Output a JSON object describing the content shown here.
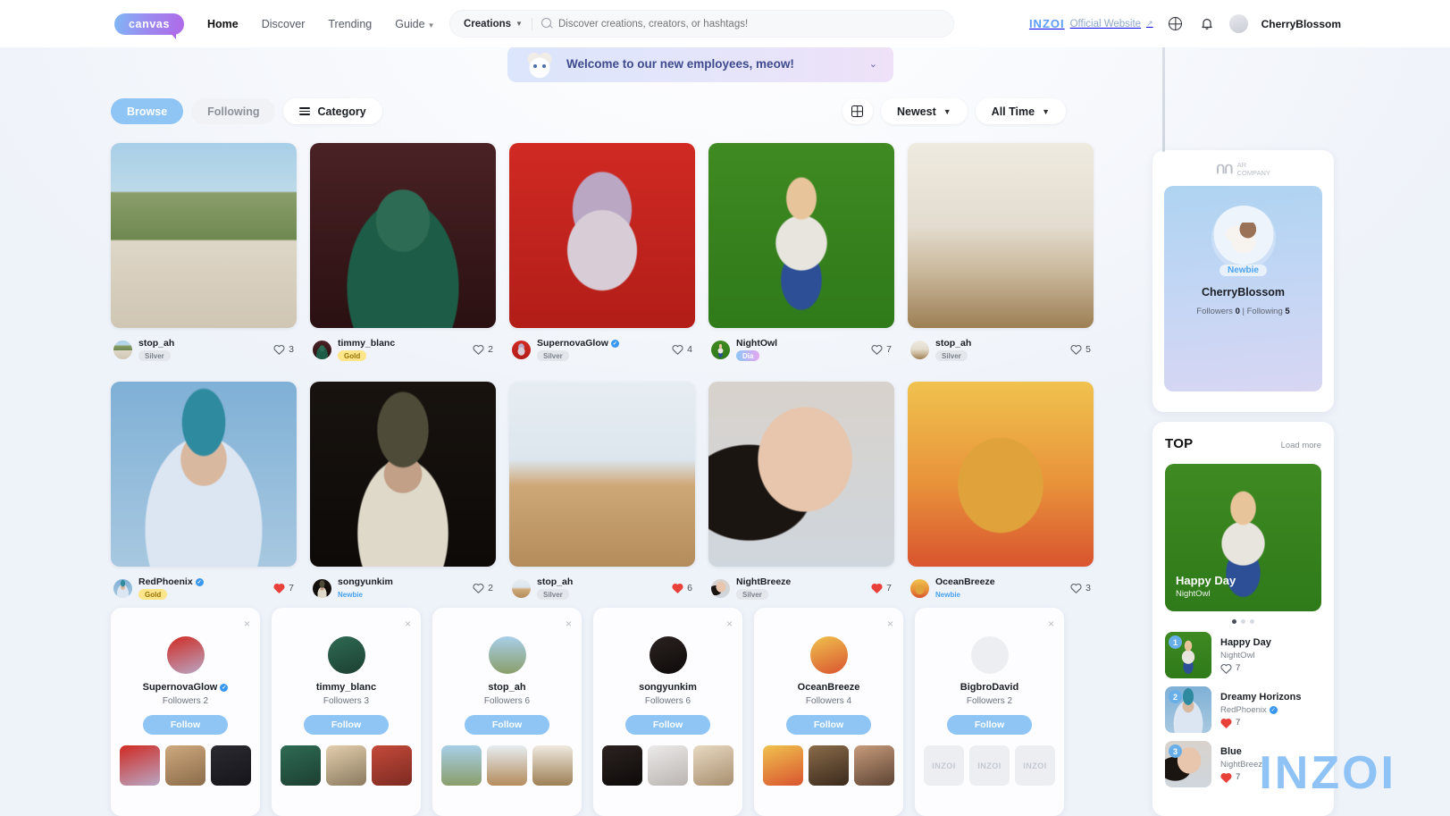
{
  "header": {
    "logo_text": "canvas",
    "nav": [
      {
        "label": "Home",
        "active": true
      },
      {
        "label": "Discover",
        "active": false
      },
      {
        "label": "Trending",
        "active": false
      },
      {
        "label": "Guide",
        "active": false,
        "caret": true
      }
    ],
    "search": {
      "scope_label": "Creations",
      "placeholder": "Discover creations, creators, or hashtags!",
      "value": ""
    },
    "inzoi_mark": "INZOI",
    "inzoi_link_label": "Official Website",
    "icons": {
      "globe": "globe-icon",
      "bell": "bell-icon"
    },
    "user_name": "CherryBlossom"
  },
  "banner": {
    "text": "Welcome to our new employees, meow!",
    "chevron": "⌄"
  },
  "filters": {
    "tabs": [
      {
        "label": "Browse",
        "active": true
      },
      {
        "label": "Following",
        "active": false
      }
    ],
    "category_label": "Category",
    "sort_label": "Newest",
    "time_label": "All Time"
  },
  "gallery": {
    "rows": [
      [
        {
          "user": "stop_ah",
          "badge": "Silver",
          "badge_type": "silver",
          "verified": false,
          "likes": "3",
          "liked": false,
          "thumb": "house-exterior"
        },
        {
          "user": "timmy_blanc",
          "badge": "Gold",
          "badge_type": "gold",
          "verified": false,
          "likes": "2",
          "liked": false,
          "thumb": "green-dress-portrait"
        },
        {
          "user": "SupernovaGlow",
          "badge": "Silver",
          "badge_type": "silver",
          "verified": true,
          "likes": "4",
          "liked": false,
          "thumb": "pigtails-red-bg"
        },
        {
          "user": "NightOwl",
          "badge": "Dia",
          "badge_type": "dia",
          "verified": false,
          "likes": "7",
          "liked": false,
          "thumb": "baseball-boy-green"
        },
        {
          "user": "stop_ah",
          "badge": "Silver",
          "badge_type": "silver",
          "verified": false,
          "likes": "5",
          "liked": false,
          "thumb": "living-room-interior"
        }
      ],
      [
        {
          "user": "RedPhoenix",
          "badge": "Gold",
          "badge_type": "gold",
          "verified": true,
          "likes": "7",
          "liked": true,
          "thumb": "beanie-girl-sky"
        },
        {
          "user": "songyunkim",
          "badge": "Newbie",
          "badge_type": "newbie",
          "verified": false,
          "likes": "2",
          "liked": false,
          "thumb": "bucket-hat-dark"
        },
        {
          "user": "stop_ah",
          "badge": "Silver",
          "badge_type": "silver",
          "verified": false,
          "likes": "6",
          "liked": true,
          "thumb": "home-gym-interior"
        },
        {
          "user": "NightBreeze",
          "badge": "Silver",
          "badge_type": "silver",
          "verified": false,
          "likes": "7",
          "liked": true,
          "thumb": "closeup-face-portrait"
        },
        {
          "user": "OceanBreeze",
          "badge": "Newbie",
          "badge_type": "newbie",
          "verified": false,
          "likes": "3",
          "liked": false,
          "thumb": "muscular-sunset"
        }
      ]
    ]
  },
  "suggestions": {
    "follow_label": "Follow",
    "close_label": "×",
    "cards": [
      {
        "name": "SupernovaGlow",
        "verified": true,
        "followers": "Followers 2",
        "minis": [
          "pigtails",
          "blond-man",
          "dark-suit"
        ]
      },
      {
        "name": "timmy_blanc",
        "verified": false,
        "followers": "Followers 3",
        "minis": [
          "green-dress",
          "blond-portrait",
          "red-hair"
        ]
      },
      {
        "name": "stop_ah",
        "verified": false,
        "followers": "Followers 6",
        "minis": [
          "house",
          "gym",
          "bedroom"
        ]
      },
      {
        "name": "songyunkim",
        "verified": false,
        "followers": "Followers 6",
        "minis": [
          "dark-portrait",
          "white-hair",
          "hat-girl"
        ]
      },
      {
        "name": "OceanBreeze",
        "verified": false,
        "followers": "Followers 4",
        "minis": [
          "sunset-man",
          "sunglasses",
          "portrait"
        ]
      },
      {
        "name": "BigbroDavid",
        "verified": false,
        "followers": "Followers 2",
        "minis": [
          "inzoi-placeholder",
          "inzoi-placeholder",
          "inzoi-placeholder"
        ]
      }
    ]
  },
  "sidebar": {
    "company_mark": "AR",
    "company_name_line1": "AR",
    "company_name_line2": "COMPANY",
    "profile": {
      "badge": "Newbie",
      "name": "CherryBlossom",
      "followers_label": "Followers",
      "followers_value": "0",
      "separator": "|",
      "following_label": "Following",
      "following_value": "5"
    },
    "top": {
      "title": "TOP",
      "load_more": "Load more",
      "hero": {
        "title": "Happy Day",
        "author": "NightOwl",
        "thumb": "baseball-boy-green"
      },
      "carousel_dots": 3,
      "carousel_active": 0,
      "ranks": [
        {
          "rank": "1",
          "title": "Happy Day",
          "author": "NightOwl",
          "verified": false,
          "likes": "7",
          "liked": false,
          "thumb": "baseball-boy-green"
        },
        {
          "rank": "2",
          "title": "Dreamy Horizons",
          "author": "RedPhoenix",
          "verified": true,
          "likes": "7",
          "liked": true,
          "thumb": "beanie-girl-sky"
        },
        {
          "rank": "3",
          "title": "Blue",
          "author": "NightBreeze",
          "verified": false,
          "likes": "7",
          "liked": true,
          "thumb": "closeup-face-portrait"
        }
      ]
    }
  },
  "watermark": "INZOI",
  "colors": {
    "accent": "#8ec5f5",
    "heart_active": "#e8413a",
    "gold": "#fde68a",
    "silver": "#e3e6eb",
    "newbie": "#4aa3f0"
  }
}
